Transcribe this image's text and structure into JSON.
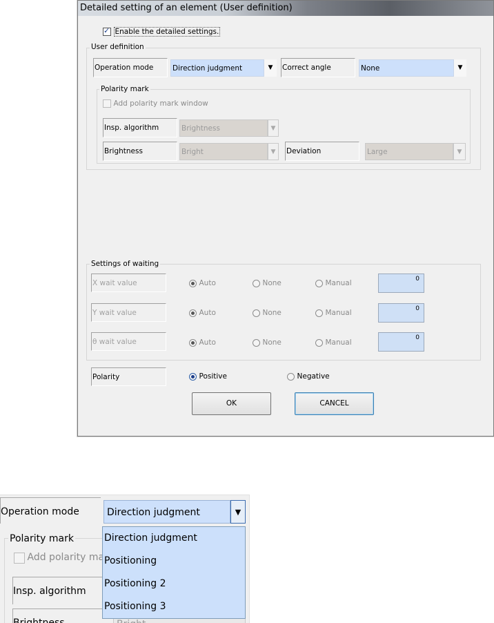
{
  "dialog": {
    "title": "Detailed setting of an element  (User definition)",
    "enable_checkbox_label": "Enable the detailed settings.",
    "enable_checked": true
  },
  "user_definition": {
    "group_label": "User definition",
    "operation_mode_label": "Operation mode",
    "operation_mode_value": "Direction judgment",
    "correct_angle_label": "Correct angle",
    "correct_angle_value": "None"
  },
  "polarity_mark": {
    "group_label": "Polarity mark",
    "add_window_label": "Add polarity mark window",
    "add_window_checked": false,
    "insp_algorithm_label": "Insp. algorithm",
    "insp_algorithm_value": "Brightness",
    "brightness_label": "Brightness",
    "brightness_value": "Bright",
    "deviation_label": "Deviation",
    "deviation_value": "Large"
  },
  "waiting": {
    "group_label": "Settings of waiting",
    "option_auto": "Auto",
    "option_none": "None",
    "option_manual": "Manual",
    "rows": [
      {
        "label": "X wait value",
        "value": "0",
        "selected": "Auto"
      },
      {
        "label": "Y wait value",
        "value": "0",
        "selected": "Auto"
      },
      {
        "label": "θ wait value",
        "value": "0",
        "selected": "Auto"
      }
    ]
  },
  "polarity": {
    "label": "Polarity",
    "positive": "Positive",
    "negative": "Negative",
    "selected": "Positive"
  },
  "buttons": {
    "ok": "OK",
    "cancel": "CANCEL"
  },
  "zoom": {
    "operation_mode_label": "Operation mode",
    "operation_mode_value": "Direction judgment",
    "polarity_mark_label": "Polarity mark",
    "add_window_label": "Add polarity mark",
    "insp_algorithm_label": "Insp. algorithm",
    "brightness_label": "Brightness",
    "brightness_value": "Bright",
    "options": [
      "Direction judgment",
      "Positioning",
      "Positioning 2",
      "Positioning 3"
    ]
  },
  "colors": {
    "combo_fill": "#cde0fb",
    "disabled_combo_fill": "#d9d5d0",
    "dialog_bg": "#f0f0f0"
  },
  "icons": {
    "dropdown": "chevron-down-icon",
    "checkbox": "checkbox-icon",
    "radio": "radio-icon"
  }
}
